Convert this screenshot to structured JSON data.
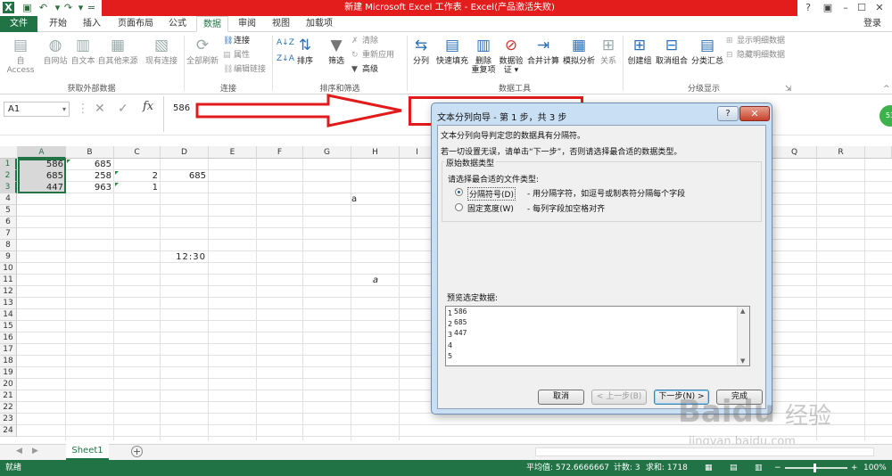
{
  "window": {
    "title": "新建 Microsoft Excel 工作表 - Excel(产品激活失败)",
    "controls": [
      "?",
      "–",
      "☐",
      "✕"
    ],
    "login": "登录"
  },
  "tabs": [
    {
      "label": "文件"
    },
    {
      "label": "开始"
    },
    {
      "label": "插入"
    },
    {
      "label": "页面布局"
    },
    {
      "label": "公式"
    },
    {
      "label": "数据"
    },
    {
      "label": "审阅"
    },
    {
      "label": "视图"
    },
    {
      "label": "加载项"
    }
  ],
  "ribbon": {
    "ext_data": {
      "access": "自 Access",
      "web": "自网站",
      "text": "自文本",
      "other": "自其他来源",
      "existing": "现有连接",
      "group": "获取外部数据"
    },
    "connections": {
      "refresh_all": "全部刷新",
      "connections": "连接",
      "properties": "属性",
      "edit_links": "编辑链接",
      "group": "连接"
    },
    "sort_filter": {
      "sort": "排序",
      "filter": "筛选",
      "clear": "清除",
      "reapply": "重新应用",
      "advanced": "高级",
      "group": "排序和筛选"
    },
    "data_tools": {
      "split": "分列",
      "flash_fill": "快速填充",
      "remove_dup_1": "删除",
      "remove_dup_2": "重复项",
      "validation_1": "数据验",
      "validation_2": "证 ▾",
      "consolidate": "合并计算",
      "whatif": "模拟分析",
      "relations": "关系",
      "group": "数据工具"
    },
    "outline": {
      "group_btn": "创建组",
      "ungroup": "取消组合",
      "subtotal": "分类汇总",
      "show_detail": "显示明细数据",
      "hide_detail": "隐藏明细数据",
      "group": "分级显示"
    }
  },
  "formula_bar": {
    "name_box": "A1",
    "fx": "fx",
    "content": "586"
  },
  "grid": {
    "columns": [
      "A",
      "B",
      "C",
      "D",
      "E",
      "F",
      "G",
      "H",
      "I",
      "Q",
      "R"
    ],
    "rows": [
      "1",
      "2",
      "3",
      "4",
      "5",
      "6",
      "7",
      "8",
      "9",
      "10",
      "11",
      "12",
      "13",
      "14",
      "15",
      "16",
      "17",
      "18",
      "19",
      "20",
      "21",
      "22",
      "23",
      "24"
    ],
    "cells": {
      "A1": "586",
      "A2": "685",
      "A3": "447",
      "B1": "685",
      "B2": "258",
      "B3": "963",
      "C2": "2",
      "C3": "1",
      "D2": "685",
      "D9": "12:30",
      "H4": "a",
      "H11": "a"
    }
  },
  "sheet": {
    "tab": "Sheet1",
    "add": "+"
  },
  "status": {
    "ready": "就绪",
    "average": "平均值: 572.6666667",
    "count": "计数: 3",
    "sum": "求和: 1718",
    "zoom": "100%"
  },
  "dialog": {
    "title": "文本分列向导 - 第 1 步，共 3 步",
    "help": "?",
    "close": "✕",
    "line1": "文本分列向导判定您的数据具有分隔符。",
    "line2": "若一切设置无误，请单击“下一步”，否则请选择最合适的数据类型。",
    "section": "原始数据类型",
    "prompt": "请选择最合适的文件类型:",
    "opt1": "分隔符号(D)",
    "opt1_desc": "- 用分隔字符，如逗号或制表符分隔每个字段",
    "opt2": "固定宽度(W)",
    "opt2_desc": "- 每列字段加空格对齐",
    "preview_label": "预览选定数据:",
    "preview_nums": [
      "1",
      "2",
      "3",
      "4",
      "5"
    ],
    "preview_vals": [
      "586",
      "685",
      "447"
    ],
    "buttons": {
      "cancel": "取消",
      "back": "< 上一步(B)",
      "next": "下一步(N) >",
      "finish": "完成"
    }
  },
  "watermark": {
    "brand": "Baidu",
    "sub": "经验",
    "url": "jingyan.baidu.com"
  }
}
